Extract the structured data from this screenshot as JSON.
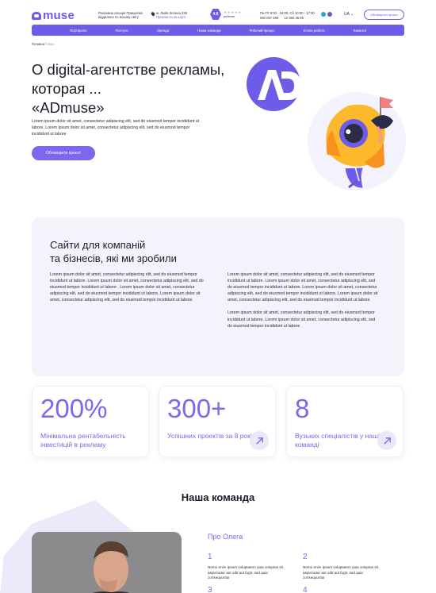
{
  "header": {
    "logo_text": "muse",
    "tagline": "Рекламна агенція Працюємо віддалено по всьому світу",
    "address": "м. Львів Зелена 238",
    "address_link": "Прокласти на карті",
    "rating_value": "4.8",
    "rating_stars": "★★★★★",
    "rating_label": "рейтинг",
    "hours": "Пн-Пт 9:00 - 18:00, Сб 10:00 - 17:00",
    "phone_1": "080 057 469",
    "phone_2": "12 360 36 65",
    "language": "UA ⌄",
    "cta": "Обговорити проєкт"
  },
  "nav": {
    "items": [
      "Портфоліо",
      "Послуги",
      "Оренда",
      "Наша команда",
      "Робочий процес",
      "Етапи роботи",
      "Вакансії"
    ]
  },
  "breadcrumb": {
    "home": "Головна /",
    "current": " Інше"
  },
  "hero": {
    "title_line1": "О digital-агентстве рекламы,",
    "title_line2": "которая ...",
    "title_line3": "«ADmuse»",
    "text": "Lorem ipsum dolor sit amet, consectetur adipiscing elit, sed do eiusmod tempor incididunt ut labore. Lorem ipsum dolor sit amet, consectetur adipiscing elit, sed do eiusmod tempor incididunt ut labore",
    "button": "Обговорити проєкт"
  },
  "projects": {
    "title_line1": "Сайти для компаній",
    "title_line2": "та бізнесів, які ми зробили",
    "left_text": "Lorem ipsum dolor sit amet, consectetur adipiscing elit, sed do eiusmod tempor incididunt ut labore. Lorem ipsum dolor sit amet, consectetur adipiscing elit, sed do eiusmod tempor incididunt ut labore . Lorem ipsum dolor sit amet, consectetur adipiscing elit, sed do eiusmod tempor incididunt ut labore. Lorem ipsum dolor sit amet, consectetur adipiscing elit, sed do eiusmod tempor incididunt ut labore",
    "right_text_1": "Lorem ipsum dolor sit amet, consectetur adipiscing elit, sed do eiusmod tempor incididunt ut labore. Lorem ipsum dolor sit amet, consectetur adipiscing elit, sed do eiusmod tempor incididunt ut labore. Lorem ipsum dolor sit amet, consectetur adipiscing elit, sed do eiusmod tempor incididunt ut labore. Lorem ipsum dolor sit amet, consectetur adipiscing elit, sed do eiusmod tempor incididunt ut labore",
    "right_text_2": "Lorem ipsum dolor sit amet, consectetur adipiscing elit, sed do eiusmod tempor incididunt ut labore. Lorem ipsum dolor sit amet, consectetur adipiscing elit, sed do eiusmod tempor incididunt ut labore"
  },
  "stats": [
    {
      "value": "200%",
      "label": "Мінімальна рентабельність інвестицій в рекламу"
    },
    {
      "value": "300+",
      "label": "Успішних проектів за 8 років"
    },
    {
      "value": "8",
      "label": "Вузьких спеціалістів у нашій команді"
    }
  ],
  "team": {
    "title": "Наша команда",
    "about_title": "Про Олега",
    "points": [
      {
        "num": "1",
        "text": "Nemo enim ipsam voluptatem quia voluptas sit aspernatur aut odit aut fugit, sed quia consequuntur"
      },
      {
        "num": "2",
        "text": "Nemo enim ipsam voluptatem quia voluptas sit aspernatur aut odit aut fugit, sed quia consequuntur"
      },
      {
        "num": "3",
        "text": ""
      },
      {
        "num": "4",
        "text": ""
      }
    ]
  },
  "colors": {
    "accent": "#6c5ce7",
    "accent_light": "#7b68ee",
    "panel_bg": "#f3f3fb",
    "rocket_orange": "#f7931e",
    "rocket_yellow": "#fcb92c"
  }
}
